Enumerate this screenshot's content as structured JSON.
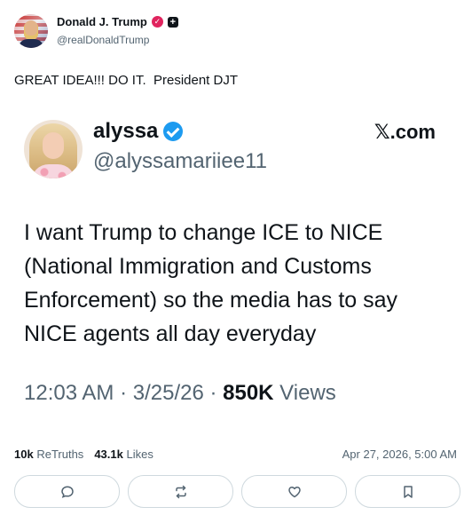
{
  "author": {
    "display_name": "Donald J. Trump",
    "handle": "@realDonaldTrump"
  },
  "post": {
    "text": "GREAT IDEA!!! DO IT.  President DJT"
  },
  "embed": {
    "name": "alyssa",
    "handle": "@alyssamariiee11",
    "source": "𝕏.com",
    "text": "I want Trump to change ICE to NICE (National Immigration and Customs Enforcement) so the media has to say NICE agents all day everyday",
    "time": "12:03 AM · 3/25/26 · ",
    "views_count": "850K",
    "views_label": " Views"
  },
  "stats": {
    "retruths_count": "10k",
    "retruths_label": "ReTruths",
    "likes_count": "43.1k",
    "likes_label": "Likes",
    "timestamp": "Apr 27, 2026, 5:00 AM"
  },
  "actions": [
    {
      "icon": "reply-icon"
    },
    {
      "icon": "retruth-icon"
    },
    {
      "icon": "like-icon"
    },
    {
      "icon": "bookmark-icon"
    }
  ],
  "colors": {
    "badge_verified_truth": "#e0245e",
    "badge_verified_x": "#1d9bf0",
    "muted_text": "#536471"
  }
}
